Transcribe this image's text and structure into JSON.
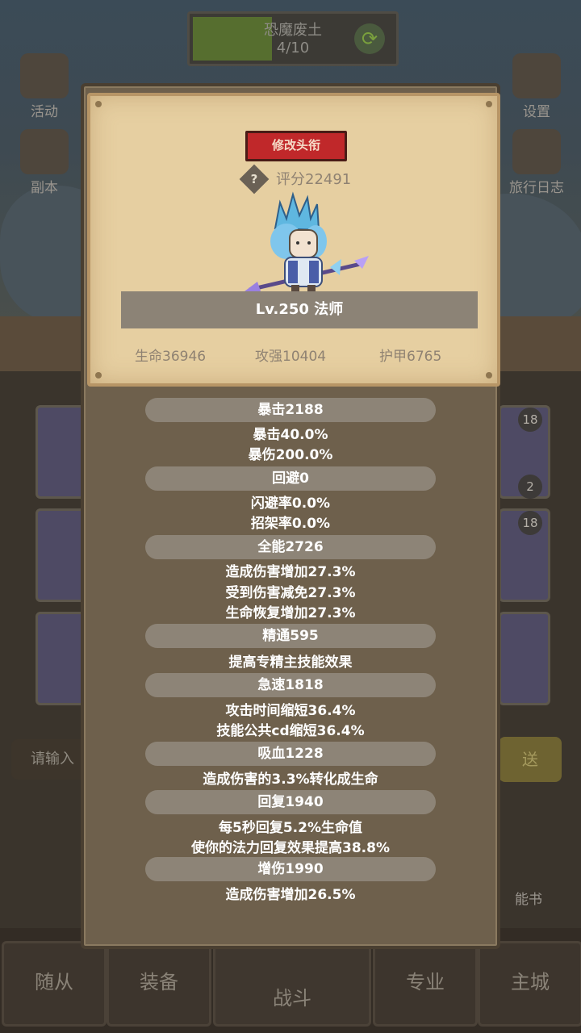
{
  "background": {
    "stage": {
      "name": "恐魔废土",
      "progress": "4/10"
    },
    "left_icons": [
      "活动",
      "副本"
    ],
    "right_icons": [
      "设置",
      "旅行日志"
    ],
    "badges": [
      "18",
      "2",
      "18"
    ],
    "input_placeholder": "请输入",
    "send_label": "送",
    "right_side_label": "能书",
    "tabs": [
      "随从",
      "装备",
      "战斗",
      "专业",
      "主城"
    ]
  },
  "profile": {
    "change_title_button": "修改头衔",
    "help_icon": "?",
    "score": "评分22491",
    "level_class": "Lv.250 法师",
    "hp": "生命36946",
    "attack": "攻强10404",
    "armor": "护甲6765"
  },
  "stats": [
    {
      "header": "暴击2188",
      "lines": [
        "暴击40.0%",
        "暴伤200.0%"
      ]
    },
    {
      "header": "回避0",
      "lines": [
        "闪避率0.0%",
        "招架率0.0%"
      ]
    },
    {
      "header": "全能2726",
      "lines": [
        "造成伤害增加27.3%",
        "受到伤害减免27.3%",
        "生命恢复增加27.3%"
      ]
    },
    {
      "header": "精通595",
      "lines": [
        "提高专精主技能效果"
      ]
    },
    {
      "header": "急速1818",
      "lines": [
        "攻击时间缩短36.4%",
        "技能公共cd缩短36.4%"
      ]
    },
    {
      "header": "吸血1228",
      "lines": [
        "造成伤害的3.3%转化成生命"
      ]
    },
    {
      "header": "回复1940",
      "lines": [
        "每5秒回复5.2%生命值",
        "使你的法力回复效果提高38.8%"
      ]
    },
    {
      "header": "增伤1990",
      "lines": [
        "造成伤害增加26.5%"
      ]
    }
  ],
  "colors": {
    "parchment": "#e6cfa1",
    "modal": "#6e604c",
    "pill": "#8d8477",
    "button_red": "#c0282a"
  }
}
